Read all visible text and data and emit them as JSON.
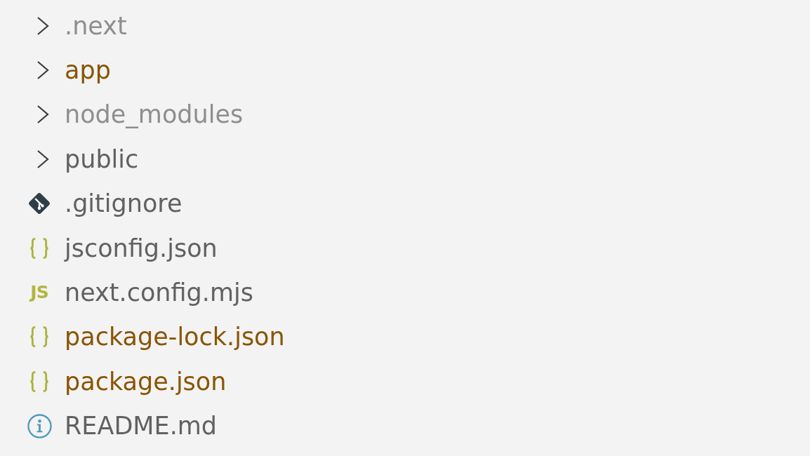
{
  "explorer": {
    "items": [
      {
        "kind": "folder",
        "name": ".next",
        "expanded": false,
        "color": "#8e8e8e"
      },
      {
        "kind": "folder",
        "name": "app",
        "expanded": false,
        "color": "#895503"
      },
      {
        "kind": "folder",
        "name": "node_modules",
        "expanded": false,
        "color": "#8e8e8e"
      },
      {
        "kind": "folder",
        "name": "public",
        "expanded": false,
        "color": "#616161"
      },
      {
        "kind": "git",
        "name": ".gitignore",
        "color": "#616161"
      },
      {
        "kind": "json",
        "name": "jsconfig.json",
        "color": "#616161"
      },
      {
        "kind": "js",
        "icon_text": "JS",
        "name": "next.config.mjs",
        "color": "#616161"
      },
      {
        "kind": "json",
        "name": "package-lock.json",
        "color": "#895503"
      },
      {
        "kind": "json",
        "name": "package.json",
        "color": "#895503"
      },
      {
        "kind": "info",
        "name": "README.md",
        "color": "#616161"
      }
    ]
  }
}
